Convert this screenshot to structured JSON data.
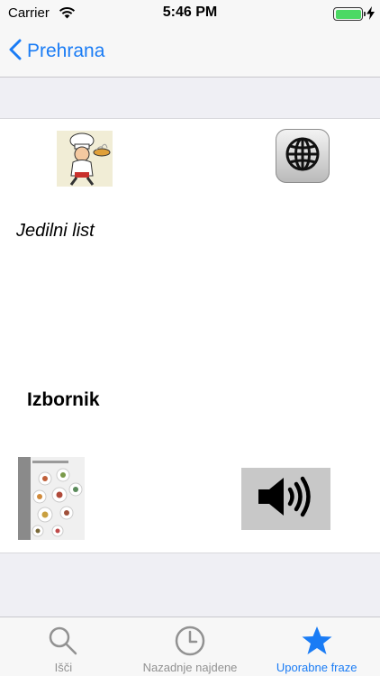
{
  "status_bar": {
    "carrier": "Carrier",
    "time": "5:46 PM",
    "battery_level": 1.0
  },
  "nav": {
    "back_label": "Prehrana"
  },
  "content": {
    "label_italic": "Jedilni list",
    "label_bold": "Izbornik"
  },
  "tabs": [
    {
      "label": "Išči",
      "icon": "search-icon",
      "active": false
    },
    {
      "label": "Nazadnje najdene",
      "icon": "clock-icon",
      "active": false
    },
    {
      "label": "Uporabne fraze",
      "icon": "star-icon",
      "active": true
    }
  ],
  "colors": {
    "accent": "#1a7cf5",
    "battery": "#4cd964",
    "inactive": "#929292"
  }
}
